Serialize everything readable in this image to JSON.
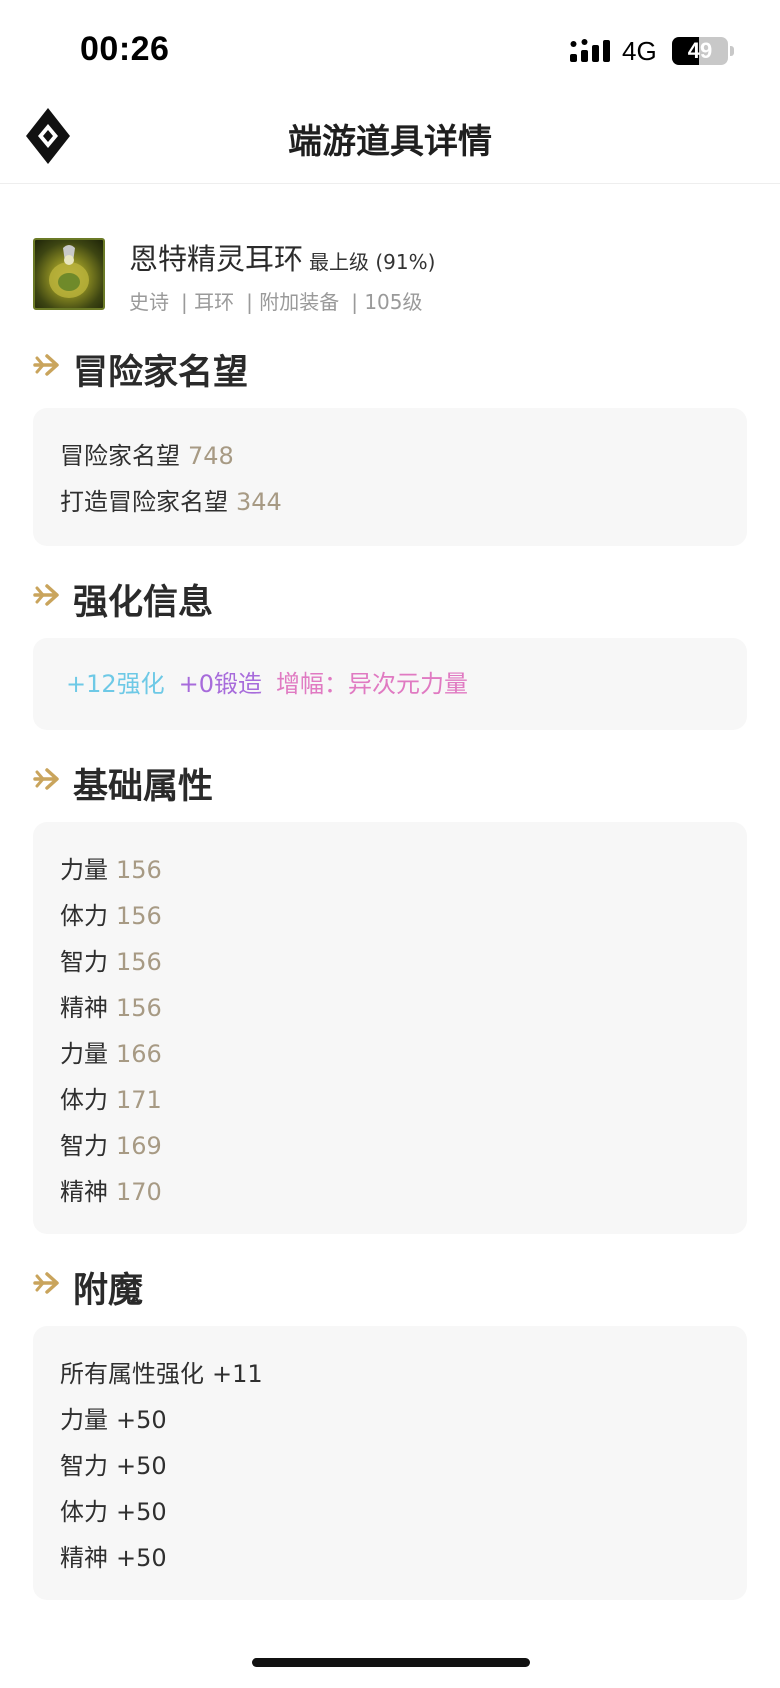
{
  "status_bar": {
    "time": "00:26",
    "network": "4G",
    "battery_text": "49",
    "battery_level": 0.49
  },
  "nav": {
    "title": "端游道具详情"
  },
  "item": {
    "name": "恩特精灵耳环",
    "grade": "最上级 (91%)",
    "meta": [
      "史诗",
      "| 耳环",
      "| 附加装备",
      "| 105级"
    ]
  },
  "sections": {
    "fame": {
      "title": "冒险家名望",
      "rows": [
        {
          "label": "冒险家名望",
          "value": "748"
        },
        {
          "label": "打造冒险家名望",
          "value": "344"
        }
      ]
    },
    "enhance": {
      "title": "强化信息",
      "reinforce": "+12强化",
      "forge": "+0锻造",
      "amplify": "增幅：异次元力量",
      "colors": {
        "reinforce": "#6ec9e6",
        "forge": "#a76bdb",
        "amplify": "#e07ac2"
      }
    },
    "base": {
      "title": "基础属性",
      "rows": [
        {
          "label": "力量",
          "value": "156"
        },
        {
          "label": "体力",
          "value": "156"
        },
        {
          "label": "智力",
          "value": "156"
        },
        {
          "label": "精神",
          "value": "156"
        },
        {
          "label": "力量",
          "value": "166"
        },
        {
          "label": "体力",
          "value": "171"
        },
        {
          "label": "智力",
          "value": "169"
        },
        {
          "label": "精神",
          "value": "170"
        }
      ]
    },
    "enchant": {
      "title": "附魔",
      "rows": [
        {
          "label": "所有属性强化",
          "value": "+11"
        },
        {
          "label": "力量",
          "value": "+50"
        },
        {
          "label": "智力",
          "value": "+50"
        },
        {
          "label": "体力",
          "value": "+50"
        },
        {
          "label": "精神",
          "value": "+50"
        }
      ]
    }
  },
  "colors": {
    "accent_gold": "#c9a45c",
    "value_gray": "#a79a84",
    "card_bg": "#f7f7f7"
  },
  "icons": {
    "logo": "diamond-logo-icon",
    "section": "arrow-right-icon",
    "item": "earring-item-icon"
  }
}
